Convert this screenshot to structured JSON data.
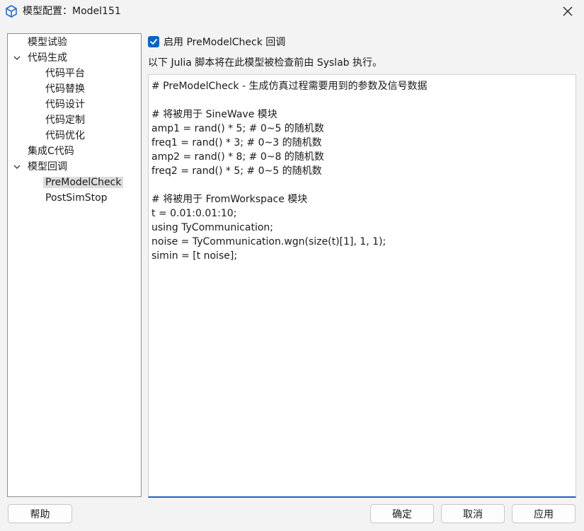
{
  "window": {
    "title": "模型配置：Model151"
  },
  "tree": {
    "items": [
      {
        "label": "模型试验"
      },
      {
        "label": "代码生成"
      },
      {
        "label": "代码平台"
      },
      {
        "label": "代码替换"
      },
      {
        "label": "代码设计"
      },
      {
        "label": "代码定制"
      },
      {
        "label": "代码优化"
      },
      {
        "label": "集成C代码"
      },
      {
        "label": "模型回调"
      },
      {
        "label": "PreModelCheck"
      },
      {
        "label": "PostSimStop"
      }
    ]
  },
  "panel": {
    "checkbox_label": "启用 PreModelCheck 回调",
    "checkbox_checked": true,
    "description": "以下 Julia 脚本将在此模型被检查前由 Syslab 执行。",
    "code_lines": [
      "# PreModelCheck - 生成仿真过程需要用到的参数及信号数据",
      "",
      "# 将被用于 SineWave 模块",
      "amp1 = rand() * 5; # 0~5 的随机数",
      "freq1 = rand() * 3; # 0~3 的随机数",
      "amp2 = rand() * 8; # 0~8 的随机数",
      "freq2 = rand() * 5; # 0~5 的随机数",
      "",
      "# 将被用于 FromWorkspace 模块",
      "t = 0.01:0.01:10;",
      "using TyCommunication;",
      "noise = TyCommunication.wgn(size(t)[1], 1, 1);",
      "simin = [t noise];"
    ]
  },
  "buttons": {
    "help": "帮助",
    "ok": "确定",
    "cancel": "取消",
    "apply": "应用"
  },
  "colors": {
    "accent": "#0b63c6",
    "selection": "#dcdcdc"
  }
}
